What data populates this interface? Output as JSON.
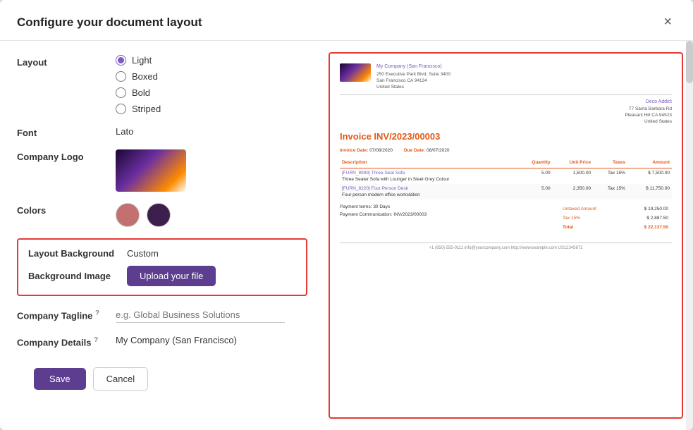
{
  "modal": {
    "title": "Configure your document layout",
    "close_label": "×"
  },
  "layout": {
    "label": "Layout",
    "options": [
      {
        "value": "light",
        "label": "Light",
        "checked": true
      },
      {
        "value": "boxed",
        "label": "Boxed",
        "checked": false
      },
      {
        "value": "bold",
        "label": "Bold",
        "checked": false
      },
      {
        "value": "striped",
        "label": "Striped",
        "checked": false
      }
    ]
  },
  "font": {
    "label": "Font",
    "value": "Lato"
  },
  "company_logo": {
    "label": "Company Logo"
  },
  "colors": {
    "label": "Colors",
    "swatches": [
      {
        "color": "#c27070"
      },
      {
        "color": "#3d1f4e"
      }
    ]
  },
  "layout_background": {
    "label": "Layout Background",
    "value": "Custom"
  },
  "background_image": {
    "label": "Background Image",
    "upload_label": "Upload your file"
  },
  "company_tagline": {
    "label": "Company Tagline",
    "placeholder": "e.g. Global Business Solutions"
  },
  "company_details": {
    "label": "Company Details",
    "value": "My Company (San Francisco)"
  },
  "footer": {
    "save_label": "Save",
    "cancel_label": "Cancel"
  },
  "preview": {
    "company_name": "My Company (San Francisco)",
    "address_line1": "250 Executive Park Blvd, Suite 3400",
    "address_line2": "San Francisco CA 94134",
    "address_line3": "United States",
    "to_name": "Deco Addict",
    "to_addr1": "77 Santa Barbara Rd",
    "to_addr2": "Pleasant Hill CA 94523",
    "to_addr3": "United States",
    "invoice_title": "Invoice INV/2023/00003",
    "invoice_date_label": "Invoice Date:",
    "invoice_date": "07/08/2020",
    "due_date_label": "Due Date:",
    "due_date": "08/07/2020",
    "table_headers": [
      "Description",
      "Quantity",
      "Unit Price",
      "Taxes",
      "Amount"
    ],
    "table_rows": [
      {
        "desc": "[FURN_8999] Three-Seat Sofa",
        "desc2": "Three Seater Sofa with Lounger in Steel Grey Colour",
        "qty": "5.00",
        "unit": "1,500.00",
        "tax": "Tax 15%",
        "amount": "$ 7,500.00"
      },
      {
        "desc": "[FURN_8220] Four Person Desk",
        "desc2": "Four person modern office workstation",
        "qty": "5.00",
        "unit": "2,350.00",
        "tax": "Tax 15%",
        "amount": "$ 11,750.00"
      }
    ],
    "payment_terms": "Payment terms: 30 Days",
    "payment_comm": "Payment Communication: INV/2023/00003",
    "untaxed_label": "Untaxed Amount",
    "untaxed_value": "$ 19,250.00",
    "tax_label": "Tax 15%",
    "tax_value": "$ 2,887.50",
    "total_label": "Total",
    "total_value": "$ 22,137.50",
    "footer_text": "+1 (650) 555-0111 info@yourcompany.com http://www.example.com US12345671"
  }
}
